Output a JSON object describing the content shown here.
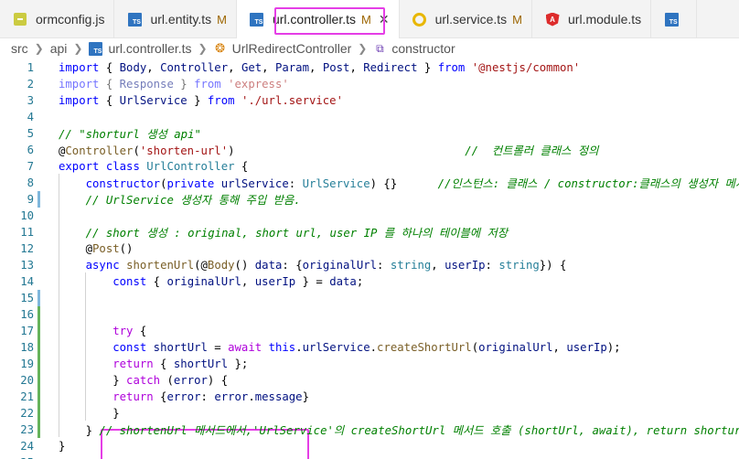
{
  "tabs": [
    {
      "label": "ormconfig.js",
      "icon": "js-file-icon",
      "modified": "",
      "active": false
    },
    {
      "label": "url.entity.ts",
      "icon": "ts-file-icon",
      "modified": "M",
      "active": false
    },
    {
      "label": "url.controller.ts",
      "icon": "ts-file-icon",
      "modified": "M",
      "active": true
    },
    {
      "label": "url.service.ts",
      "icon": "service-file-icon",
      "modified": "M",
      "active": false
    },
    {
      "label": "url.module.ts",
      "icon": "angular-file-icon",
      "modified": "",
      "active": false
    },
    {
      "label": "",
      "icon": "ts-file-icon",
      "modified": "",
      "active": false
    }
  ],
  "ts_badge": "TS",
  "ng_badge": "A",
  "close_glyph": "✕",
  "breadcrumb": [
    "src",
    "api",
    "url.controller.ts",
    "UrlRedirectController",
    "constructor"
  ],
  "colors": {
    "highlight": "#e53ee6",
    "keyword": "#0000ff",
    "string": "#a31515",
    "comment": "#008000"
  },
  "code": {
    "lines": [
      {
        "n": "1",
        "tokens": [
          [
            "kw",
            "import"
          ],
          [
            "pun",
            " { "
          ],
          [
            "var",
            "Body"
          ],
          [
            "pun",
            ", "
          ],
          [
            "var",
            "Controller"
          ],
          [
            "pun",
            ", "
          ],
          [
            "var",
            "Get"
          ],
          [
            "pun",
            ", "
          ],
          [
            "var",
            "Param"
          ],
          [
            "pun",
            ", "
          ],
          [
            "var",
            "Post"
          ],
          [
            "pun",
            ", "
          ],
          [
            "var",
            "Redirect"
          ],
          [
            "pun",
            " } "
          ],
          [
            "kw",
            "from"
          ],
          [
            "pun",
            " "
          ],
          [
            "str",
            "'@nestjs/common'"
          ]
        ]
      },
      {
        "n": "2",
        "faded": true,
        "tokens": [
          [
            "kw",
            "import"
          ],
          [
            "pun",
            " { "
          ],
          [
            "var",
            "Response"
          ],
          [
            "pun",
            " } "
          ],
          [
            "kw",
            "from"
          ],
          [
            "pun",
            " "
          ],
          [
            "str",
            "'express'"
          ]
        ]
      },
      {
        "n": "3",
        "tokens": [
          [
            "kw",
            "import"
          ],
          [
            "pun",
            " { "
          ],
          [
            "var",
            "UrlService"
          ],
          [
            "pun",
            " } "
          ],
          [
            "kw",
            "from"
          ],
          [
            "pun",
            " "
          ],
          [
            "str",
            "'./url.service'"
          ]
        ]
      },
      {
        "n": "4",
        "tokens": []
      },
      {
        "n": "5",
        "tokens": [
          [
            "cmt",
            "// \"shorturl 생성 api\""
          ]
        ]
      },
      {
        "n": "6",
        "tokens": [
          [
            "pun",
            "@"
          ],
          [
            "dec",
            "Controller"
          ],
          [
            "pun",
            "("
          ],
          [
            "str",
            "'shorten-url'"
          ],
          [
            "pun",
            ")                                  "
          ],
          [
            "cmt",
            "//  컨트롤러 클래스 정의"
          ]
        ]
      },
      {
        "n": "7",
        "tokens": [
          [
            "kw",
            "export"
          ],
          [
            "pun",
            " "
          ],
          [
            "kw",
            "class"
          ],
          [
            "pun",
            " "
          ],
          [
            "type",
            "UrlController"
          ],
          [
            "pun",
            " {"
          ]
        ]
      },
      {
        "n": "8",
        "tokens": [
          [
            "pun",
            "    "
          ],
          [
            "kw",
            "constructor"
          ],
          [
            "pun",
            "("
          ],
          [
            "kw",
            "private"
          ],
          [
            "pun",
            " "
          ],
          [
            "var",
            "urlService"
          ],
          [
            "pun",
            ": "
          ],
          [
            "type",
            "UrlService"
          ],
          [
            "pun",
            ") {}      "
          ],
          [
            "cmt",
            "//인스턴스: 클래스 / constructor:클래스의 생성자 메서드,"
          ]
        ]
      },
      {
        "n": "9",
        "tokens": [
          [
            "pun",
            "    "
          ],
          [
            "cmt",
            "// UrlService 생성자 통해 주입 받음."
          ]
        ]
      },
      {
        "n": "10",
        "tokens": []
      },
      {
        "n": "11",
        "tokens": [
          [
            "pun",
            "    "
          ],
          [
            "cmt",
            "// short 생성 : original, short url, user IP 를 하나의 테이블에 저장"
          ]
        ]
      },
      {
        "n": "12",
        "tokens": [
          [
            "pun",
            "    @"
          ],
          [
            "dec",
            "Post"
          ],
          [
            "pun",
            "()"
          ]
        ]
      },
      {
        "n": "13",
        "tokens": [
          [
            "pun",
            "    "
          ],
          [
            "kw",
            "async"
          ],
          [
            "pun",
            " "
          ],
          [
            "fn",
            "shortenUrl"
          ],
          [
            "pun",
            "(@"
          ],
          [
            "dec",
            "Body"
          ],
          [
            "pun",
            "() "
          ],
          [
            "var",
            "data"
          ],
          [
            "pun",
            ": {"
          ],
          [
            "var",
            "originalUrl"
          ],
          [
            "pun",
            ": "
          ],
          [
            "type",
            "string"
          ],
          [
            "pun",
            ", "
          ],
          [
            "var",
            "userIp"
          ],
          [
            "pun",
            ": "
          ],
          [
            "type",
            "string"
          ],
          [
            "pun",
            "}) {"
          ]
        ]
      },
      {
        "n": "14",
        "tokens": [
          [
            "pun",
            "        "
          ],
          [
            "kw",
            "const"
          ],
          [
            "pun",
            " { "
          ],
          [
            "var",
            "originalUrl"
          ],
          [
            "pun",
            ", "
          ],
          [
            "var",
            "userIp"
          ],
          [
            "pun",
            " } = "
          ],
          [
            "var",
            "data"
          ],
          [
            "pun",
            ";"
          ]
        ]
      },
      {
        "n": "15",
        "tokens": []
      },
      {
        "n": "16",
        "tokens": []
      },
      {
        "n": "17",
        "tokens": [
          [
            "pun",
            "        "
          ],
          [
            "ctl",
            "try"
          ],
          [
            "pun",
            " {"
          ]
        ]
      },
      {
        "n": "18",
        "tokens": [
          [
            "pun",
            "        "
          ],
          [
            "kw",
            "const"
          ],
          [
            "pun",
            " "
          ],
          [
            "var",
            "shortUrl"
          ],
          [
            "pun",
            " = "
          ],
          [
            "ctl",
            "await"
          ],
          [
            "pun",
            " "
          ],
          [
            "kw",
            "this"
          ],
          [
            "pun",
            "."
          ],
          [
            "var",
            "urlService"
          ],
          [
            "pun",
            "."
          ],
          [
            "fn",
            "createShortUrl"
          ],
          [
            "pun",
            "("
          ],
          [
            "var",
            "originalUrl"
          ],
          [
            "pun",
            ", "
          ],
          [
            "var",
            "userIp"
          ],
          [
            "pun",
            ");"
          ]
        ]
      },
      {
        "n": "19",
        "tokens": [
          [
            "pun",
            "        "
          ],
          [
            "ctl",
            "return"
          ],
          [
            "pun",
            " { "
          ],
          [
            "var",
            "shortUrl"
          ],
          [
            "pun",
            " };"
          ]
        ]
      },
      {
        "n": "20",
        "tokens": [
          [
            "pun",
            "        } "
          ],
          [
            "ctl",
            "catch"
          ],
          [
            "pun",
            " ("
          ],
          [
            "var",
            "error"
          ],
          [
            "pun",
            ") {"
          ]
        ]
      },
      {
        "n": "21",
        "tokens": [
          [
            "pun",
            "        "
          ],
          [
            "ctl",
            "return"
          ],
          [
            "pun",
            " {"
          ],
          [
            "var",
            "error"
          ],
          [
            "pun",
            ": "
          ],
          [
            "var",
            "error"
          ],
          [
            "pun",
            "."
          ],
          [
            "var",
            "message"
          ],
          [
            "pun",
            "}"
          ]
        ]
      },
      {
        "n": "22",
        "tokens": [
          [
            "pun",
            "        }"
          ]
        ]
      },
      {
        "n": "23",
        "tokens": [
          [
            "pun",
            "    } "
          ],
          [
            "cmt",
            "// shortenUrl 메서드에서,'UrlService'의 createShortUrl 메서드 호출 (shortUrl, await), return shorturl"
          ]
        ]
      },
      {
        "n": "24",
        "tokens": [
          [
            "pun",
            "}"
          ]
        ]
      },
      {
        "n": "25",
        "tokens": []
      }
    ]
  }
}
